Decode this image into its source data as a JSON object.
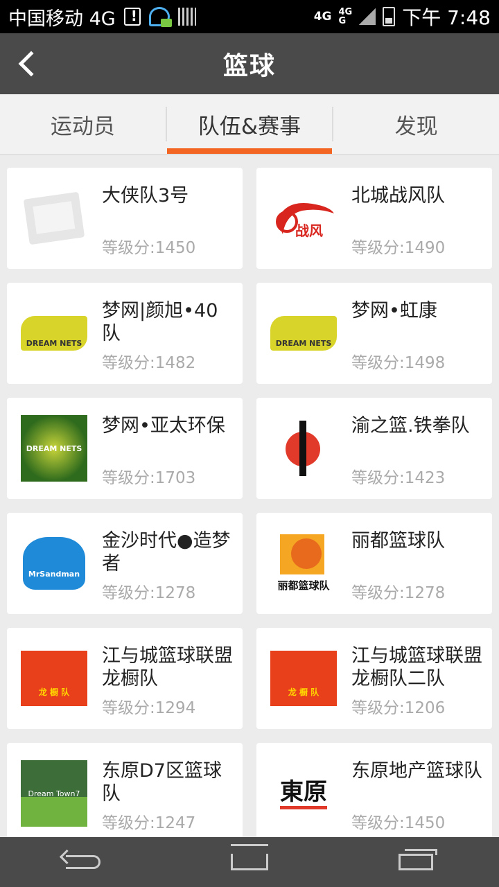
{
  "status_bar": {
    "carrier": "中国移动 4G",
    "net_label_1": "4G",
    "net_label_2": "4G",
    "net_label_3": "G",
    "time": "下午 7:48"
  },
  "header": {
    "title": "篮球"
  },
  "tabs": [
    {
      "label": "运动员",
      "active": false
    },
    {
      "label": "队伍&赛事",
      "active": true
    },
    {
      "label": "发现",
      "active": false
    }
  ],
  "accent_color": "#f26522",
  "teams": [
    {
      "name": "大侠队3号",
      "score": "等级分:1450",
      "logo": "image-placeholder-icon",
      "logo_text": ""
    },
    {
      "name": "北城战风队",
      "score": "等级分:1490",
      "logo": "red-swoosh-logo",
      "logo_text": "战风"
    },
    {
      "name": "梦网|颜旭•40队",
      "score": "等级分:1482",
      "logo": "dream-nets-logo",
      "logo_text": "DREAM NETS"
    },
    {
      "name": "梦网•虹康",
      "score": "等级分:1498",
      "logo": "dream-nets-logo",
      "logo_text": "DREAM NETS"
    },
    {
      "name": "梦网•亚太环保",
      "score": "等级分:1703",
      "logo": "dream-nets-green-logo",
      "logo_text": "DREAM NETS"
    },
    {
      "name": "渝之篮.铁拳队",
      "score": "等级分:1423",
      "logo": "player-dunk-logo",
      "logo_text": ""
    },
    {
      "name": "金沙时代●造梦者",
      "score": "等级分:1278",
      "logo": "mr-sandman-logo",
      "logo_text": "MrSandman"
    },
    {
      "name": "丽都篮球队",
      "score": "等级分:1278",
      "logo": "lidu-basketball-logo",
      "logo_text": "丽都篮球队"
    },
    {
      "name": "江与城篮球联盟龙橱队",
      "score": "等级分:1294",
      "logo": "orange-league-logo",
      "logo_text": "龙 橱 队"
    },
    {
      "name": "江与城篮球联盟龙橱队二队",
      "score": "等级分:1206",
      "logo": "orange-league-logo",
      "logo_text": "龙 橱 队"
    },
    {
      "name": "东原D7区篮球队",
      "score": "等级分:1247",
      "logo": "dream-town-logo",
      "logo_text": "Dream Town7"
    },
    {
      "name": "东原地产篮球队",
      "score": "等级分:1450",
      "logo": "dongyuan-logo",
      "logo_text": "東原"
    }
  ]
}
